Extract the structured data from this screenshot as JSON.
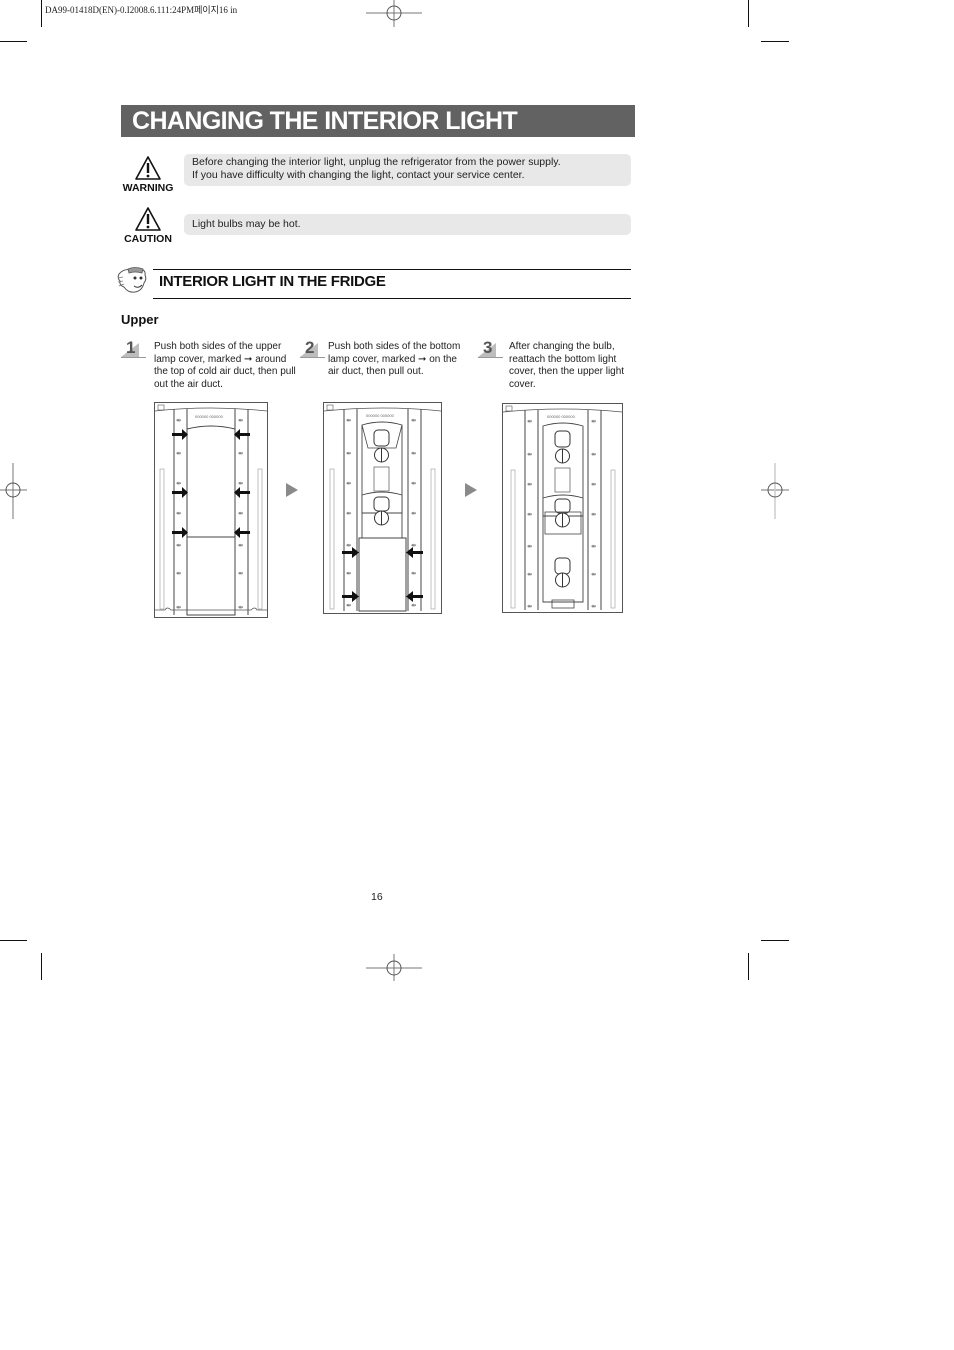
{
  "print_slug": "DA99-01418D(EN)-0.I2008.6.111:24PM페이지16  in",
  "title": "CHANGING THE INTERIOR LIGHT",
  "notices": [
    {
      "type": "warning",
      "icon": "warning-triangle-icon",
      "label": "WARNING",
      "lines": [
        "Before changing the interior light, unplug the refrigerator from the power supply.",
        "If you have difficulty with changing the light, contact your service center."
      ]
    },
    {
      "type": "caution",
      "icon": "caution-triangle-icon",
      "label": "CAUTION",
      "lines": [
        "Light bulbs may be hot."
      ]
    }
  ],
  "section": {
    "icon": "mascot-hand-icon",
    "title": "INTERIOR LIGHT IN THE FRIDGE",
    "subtitle": "Upper"
  },
  "steps": [
    {
      "number": "1",
      "text": "Push both sides of the upper lamp cover, marked ➞ around the top of cold air duct, then pull out the air duct.",
      "figure": "fridge-with-air-duct-illustration"
    },
    {
      "number": "2",
      "text": "Push both sides of the bottom lamp cover, marked ➞ on the air duct, then pull out.",
      "figure": "fridge-with-bottom-cover-illustration"
    },
    {
      "number": "3",
      "text": "After changing the bulb, reattach the bottom light cover, then the upper light cover.",
      "figure": "fridge-lamps-exposed-illustration"
    }
  ],
  "flow_arrow_icon": "right-triangle-arrow-icon",
  "page_number": "16",
  "colors": {
    "title_bar": "#626262",
    "notice_bg": "#e8e8e8",
    "step_badge": "#bdbdbd",
    "flow_arrow": "#8a8a8a"
  }
}
